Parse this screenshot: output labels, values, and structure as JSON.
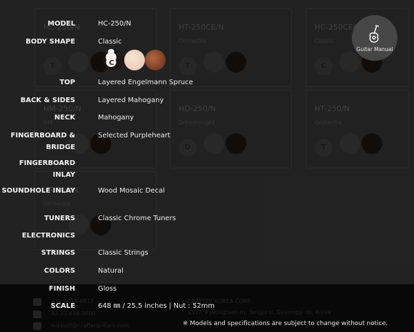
{
  "background": {
    "cards": [
      {
        "name": "HC-250/N",
        "type": "",
        "letter": "T"
      },
      {
        "name": "HT-250CE/N",
        "type": "Orchestra",
        "letter": "T"
      },
      {
        "name": "HC-250CE/N",
        "type": "Classic",
        "letter": "C"
      },
      {
        "name": "HM-250/N",
        "type": "HM",
        "letter": ""
      },
      {
        "name": "HD-250/N",
        "type": "Dreadnought",
        "letter": "D"
      },
      {
        "name": "HT-250/N",
        "type": "Orchestra",
        "letter": "T"
      },
      {
        "name": "HT-250/N",
        "type": "Orchestra",
        "letter": ""
      }
    ],
    "footer": {
      "phone": "031-8018-8817",
      "fax": "82-31-658-3600",
      "email": "support@crafterguitars.com",
      "company": "CRAFTER KOREA CORP.",
      "address": "1337, Pyeongtaek-ro, Yangju-si, Gyeonggi-do, Korea",
      "notice": "※ Models and specifications are subject to change without notice."
    }
  },
  "manual": {
    "label": "Guitar Manual",
    "icon": "guitar-icon"
  },
  "body_badge_letter": "C",
  "specs": [
    {
      "label": "MODEL",
      "value": "HC-250/N"
    },
    {
      "label": "BODY SHAPE",
      "value": "Classic"
    },
    {
      "label": "TOP",
      "value": "Layered Engelmann Spruce"
    },
    {
      "label": "BACK & SIDES",
      "value": "Layered Mahogany"
    },
    {
      "label": "NECK",
      "value": "Mahogany"
    },
    {
      "label": "FINGERBOARD & BRIDGE",
      "value": "Selected Purpleheart"
    },
    {
      "label": "FINGERBOARD INLAY",
      "value": ""
    },
    {
      "label": "SOUNDHOLE INLAY",
      "value": "Wood Mosaic Decal"
    },
    {
      "label": "TUNERS",
      "value": "Classic Chrome Tuners"
    },
    {
      "label": "ELECTRONICS",
      "value": ""
    },
    {
      "label": "STRINGS",
      "value": "Classic Strings"
    },
    {
      "label": "COLORS",
      "value": "Natural"
    },
    {
      "label": "FINISH",
      "value": "Gloss"
    },
    {
      "label": "SCALE",
      "value": "648 ㎜ / 25.5 inches | Nut : 52mm"
    }
  ],
  "colors": {
    "wood_dark": "#1e1712",
    "spruce": "#f3d9c6",
    "mahogany": "#8b4a2b",
    "overlay": "#000000"
  }
}
